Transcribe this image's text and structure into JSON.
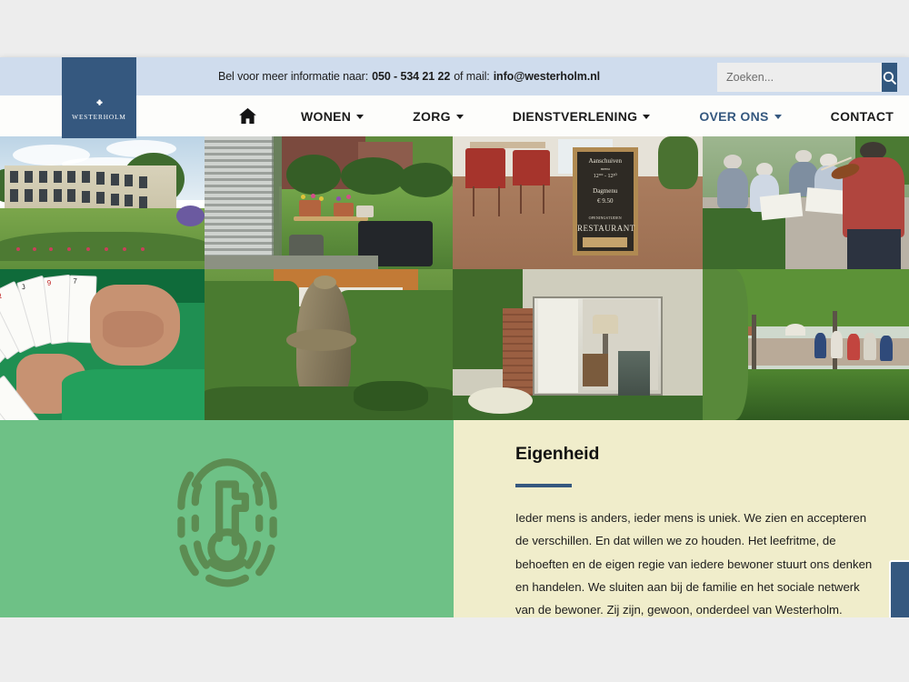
{
  "utilbar": {
    "lead_text": "Bel voor meer informatie naar:",
    "phone": "050 - 534 21 22",
    "mid_text": "of mail:",
    "email": "info@westerholm.nl",
    "search_placeholder": "Zoeken...",
    "search_value": "",
    "search_icon": "search-icon",
    "bg_color": "#cfdced"
  },
  "logo": {
    "wordmark": "WESTERHOLM",
    "emblem_icon": "quatrefoil-cross-icon",
    "bg_color": "#35587f"
  },
  "nav": {
    "home_icon": "home-icon",
    "items": [
      {
        "label": "WONEN",
        "has_caret": true,
        "active": false
      },
      {
        "label": "ZORG",
        "has_caret": true,
        "active": false
      },
      {
        "label": "DIENSTVERLENING",
        "has_caret": true,
        "active": false
      },
      {
        "label": "OVER ONS",
        "has_caret": true,
        "active": true
      },
      {
        "label": "CONTACT",
        "has_caret": false,
        "active": false
      }
    ],
    "active_color": "#35587f"
  },
  "mosaic": {
    "tiles": [
      {
        "name": "care-residence-exterior",
        "alt": "Modern zorgcomplex met gazon en bloembed"
      },
      {
        "name": "terrace-table-flowers",
        "alt": "Terrastafel met bloemen en tuinstoelen"
      },
      {
        "name": "restaurant-chalkboard",
        "alt": "Restaurant met krijtbord Aanschuiven"
      },
      {
        "name": "violinist-for-residents",
        "alt": "Violist speelt voor bewoners buiten"
      },
      {
        "name": "playing-cards-hands",
        "alt": "Handen met speelkaarten op groen kleed"
      },
      {
        "name": "bronze-statue-hedge-garden",
        "alt": "Bronzen beeld tussen hagen in de tuin"
      },
      {
        "name": "terrace-doors-lamp",
        "alt": "Terrasdeuren met schemerlamp en natuursteen"
      },
      {
        "name": "garden-party-pergola",
        "alt": "Bewoners in de tuin onder een pergola"
      }
    ],
    "chalkboard_lines": [
      "Aanschuiven",
      "menu",
      "12°° - 12³⁰",
      "Dagmenu",
      "€ 9.50",
      "RESTAURANT"
    ]
  },
  "feature": {
    "icon_name": "fingerprint-key-icon",
    "green_bg": "#6ec186",
    "cream_bg": "#f0edcb",
    "rule_color": "#35587f",
    "title": "Eigenheid",
    "body": "Ieder mens is anders, ieder mens is uniek. We zien en accepteren de verschillen. En dat willen we zo houden. Het leefritme, de behoeften en de eigen regie van iedere bewoner stuurt ons denken en handelen. We sluiten aan bij de familie en het sociale netwerk van de bewoner. Zij zijn, gewoon, onderdeel van Westerholm.",
    "side_tab_name": "feedback-side-tab"
  }
}
